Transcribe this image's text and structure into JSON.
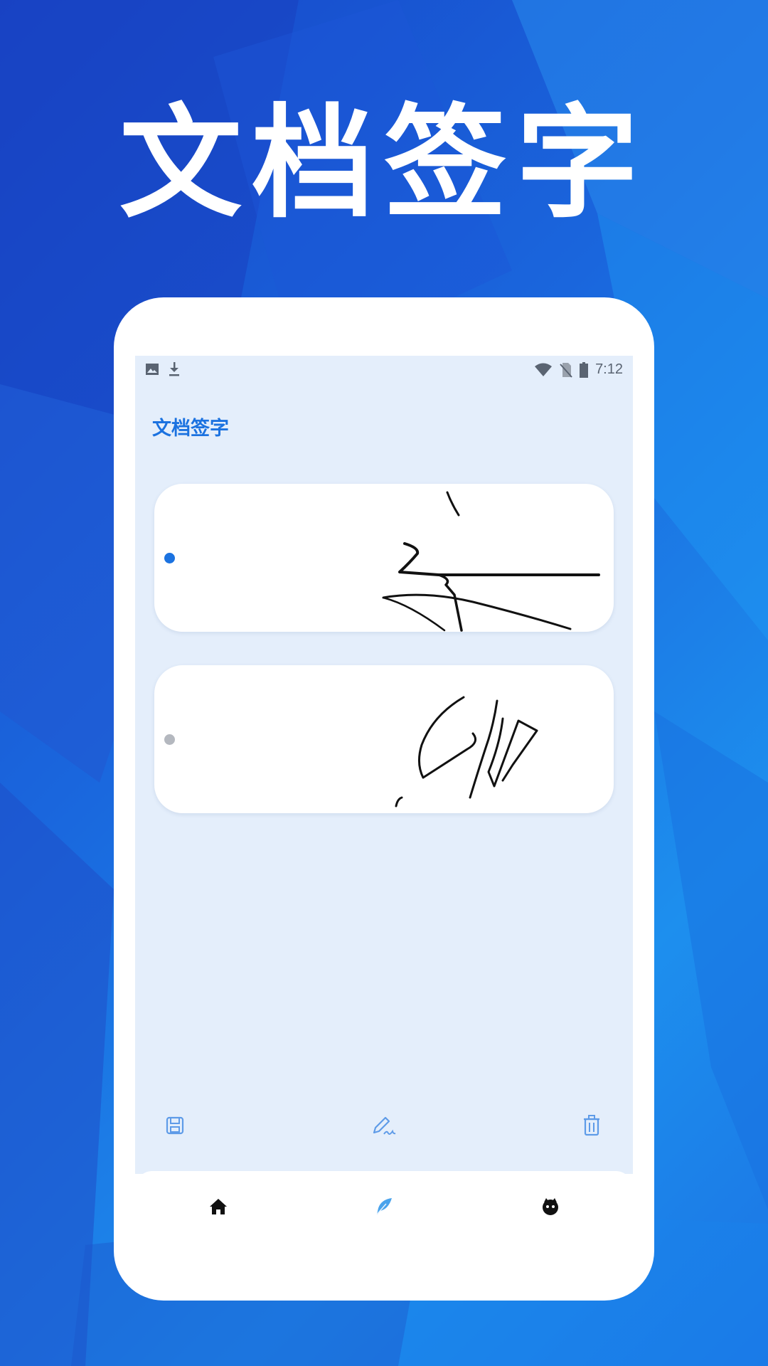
{
  "headline": "文档签字",
  "status_bar": {
    "time": "7:12",
    "left_icons": [
      "image-icon",
      "download-icon"
    ],
    "right_icons": [
      "wifi-icon",
      "no-sim-icon",
      "battery-icon"
    ]
  },
  "app": {
    "title": "文档签字",
    "accent_color": "#1b72e0"
  },
  "signatures": [
    {
      "selected": true,
      "indicator_color": "#1b72e0"
    },
    {
      "selected": false,
      "indicator_color": "#b4b8bf"
    }
  ],
  "toolbar": {
    "icons": [
      "save-icon",
      "sign-pen-icon",
      "trash-icon"
    ]
  },
  "bottom_nav": {
    "items": [
      {
        "icon": "home-icon",
        "active": false
      },
      {
        "icon": "feather-icon",
        "active": true
      },
      {
        "icon": "profile-icon",
        "active": false
      }
    ]
  }
}
